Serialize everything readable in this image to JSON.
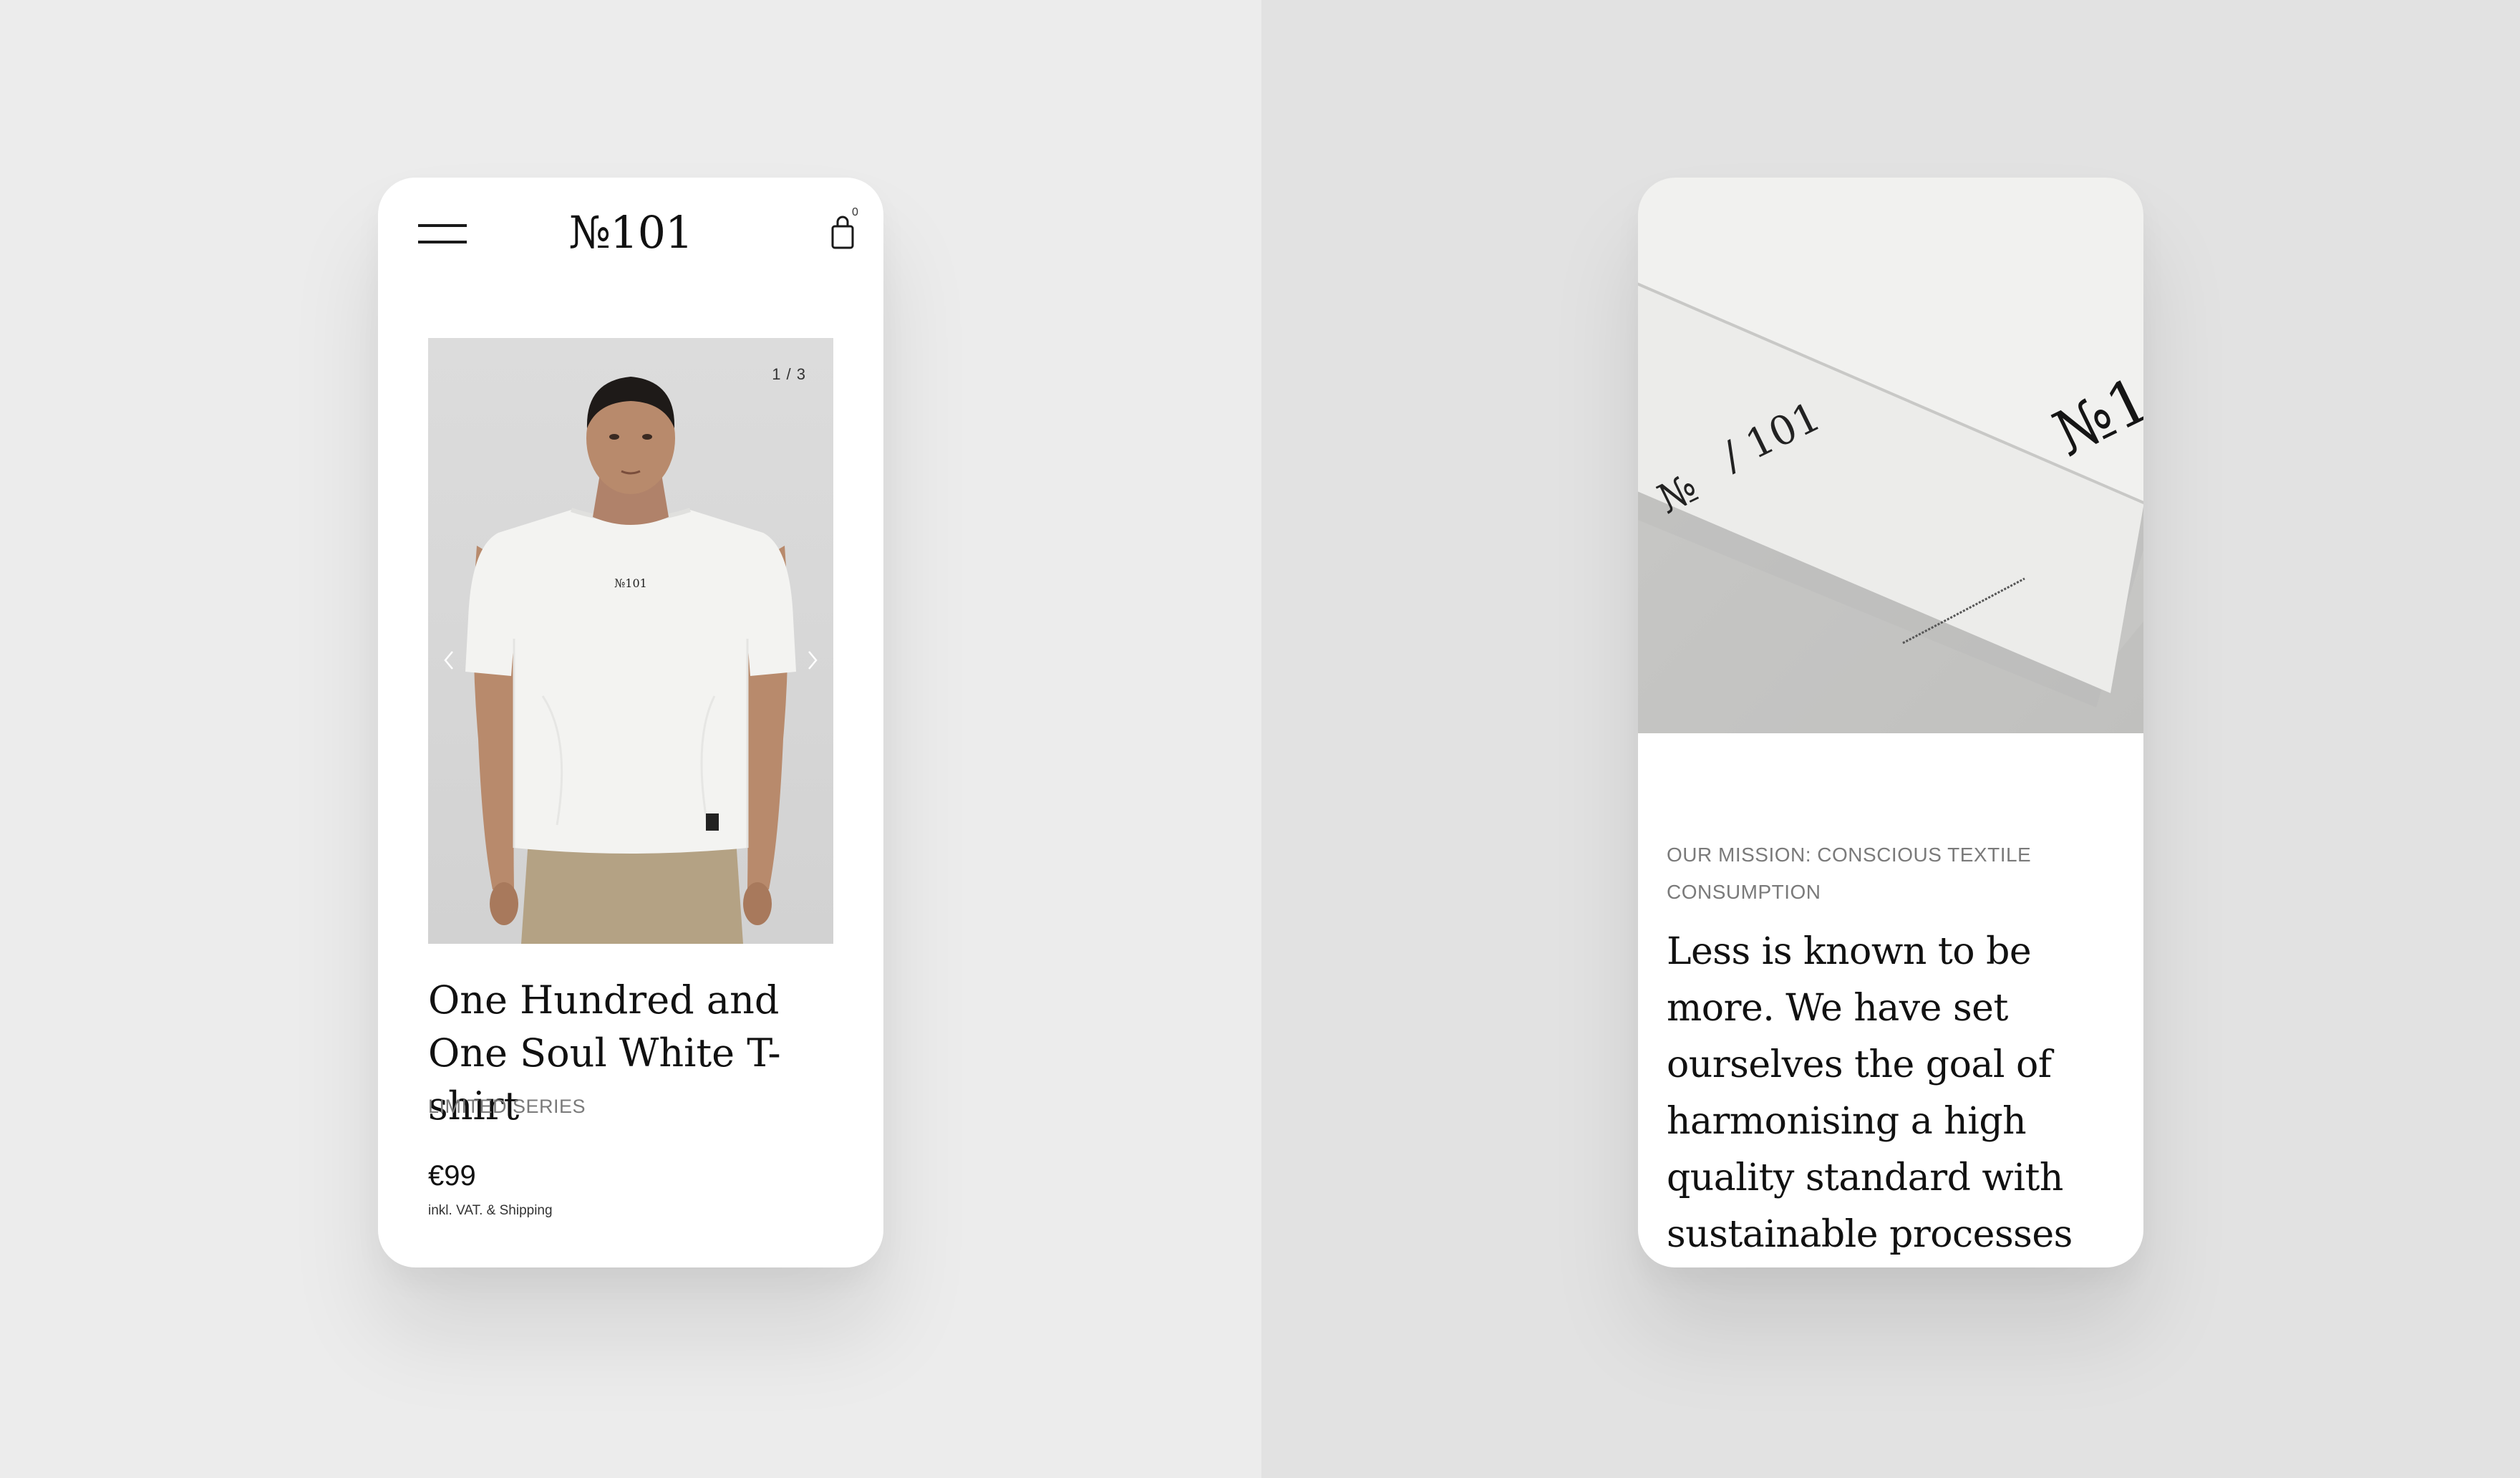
{
  "product_screen": {
    "header": {
      "logo": "№101",
      "cart_count": "0"
    },
    "gallery": {
      "counter": "1 / 3",
      "shirt_logo": "№101"
    },
    "product": {
      "title": "One Hundred and One Soul White T-shirt",
      "series": "LIMITED SERIES",
      "price": "€99",
      "price_note": "inkl. VAT. & Shipping"
    }
  },
  "mission_screen": {
    "card_text": {
      "big_logo": "№1",
      "number_left": "№",
      "number_right": "/ 101"
    },
    "eyebrow": "OUR MISSION: CONSCIOUS TEXTILE CONSUMPTION",
    "body": "Less is known to be more. We have set ourselves the goal of harmonising a high quality standard with sustainable processes and textiles. In the age of fast"
  },
  "icons": {
    "menu": "hamburger-icon",
    "cart": "shopping-bag-icon",
    "prev": "chevron-left-icon",
    "next": "chevron-right-icon"
  },
  "colors": {
    "background_left": "#ececec",
    "background_right": "#e2e2e2",
    "card": "#ffffff",
    "text": "#111111",
    "muted": "#7a7a7a"
  }
}
